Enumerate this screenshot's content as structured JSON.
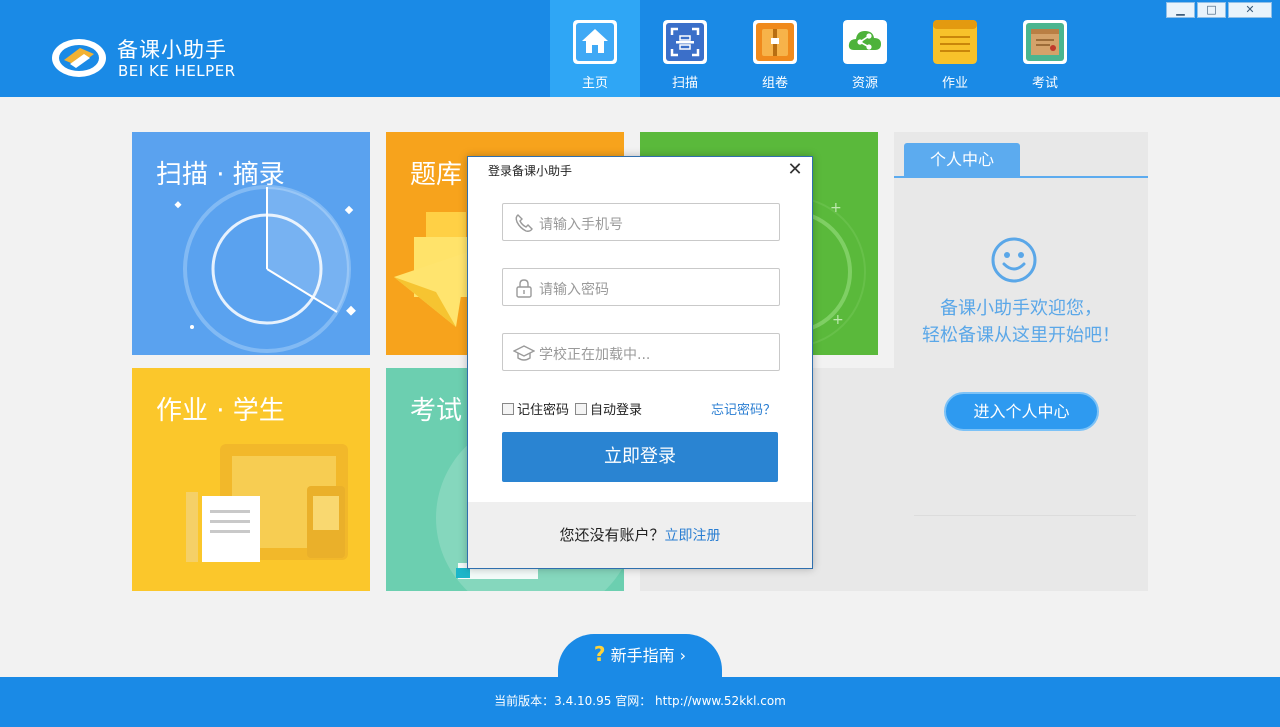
{
  "app": {
    "brand_cn": "备课小助手",
    "brand_en": "BEI KE HELPER",
    "accent_color": "#1a8ae6"
  },
  "nav": [
    {
      "label": "主页",
      "icon": "home-icon",
      "active": true
    },
    {
      "label": "扫描",
      "icon": "scan-icon",
      "active": false
    },
    {
      "label": "组卷",
      "icon": "folder-icon",
      "active": false
    },
    {
      "label": "资源",
      "icon": "share-cloud-icon",
      "active": false
    },
    {
      "label": "作业",
      "icon": "notepad-icon",
      "active": false
    },
    {
      "label": "考试",
      "icon": "envelope-icon",
      "active": false
    }
  ],
  "window_controls": {
    "minimize": "▁",
    "maximize": "□",
    "close": "✕"
  },
  "tiles": {
    "scan": "扫描 · 摘录",
    "bank": "题库",
    "homework": "作业 · 学生",
    "exam": "考试 ·"
  },
  "panel": {
    "tab": "个人中心",
    "welcome_line1": "备课小助手欢迎您，",
    "welcome_line2": "轻松备课从这里开始吧！",
    "enter_button": "进入个人中心"
  },
  "guide": {
    "q": "?",
    "label": "新手指南 ›"
  },
  "footer": {
    "text": "当前版本：3.4.10.95   官网：  http://www.52kkl.com"
  },
  "login": {
    "title": "登录备课小助手",
    "close": "✕",
    "phone_placeholder": "请输入手机号",
    "password_placeholder": "请输入密码",
    "school_placeholder": "学校正在加载中...",
    "remember": "记住密码",
    "auto_login": "自动登录",
    "forgot": "忘记密码？",
    "submit": "立即登录",
    "no_account": "您还没有账户？",
    "register": "立即注册"
  }
}
